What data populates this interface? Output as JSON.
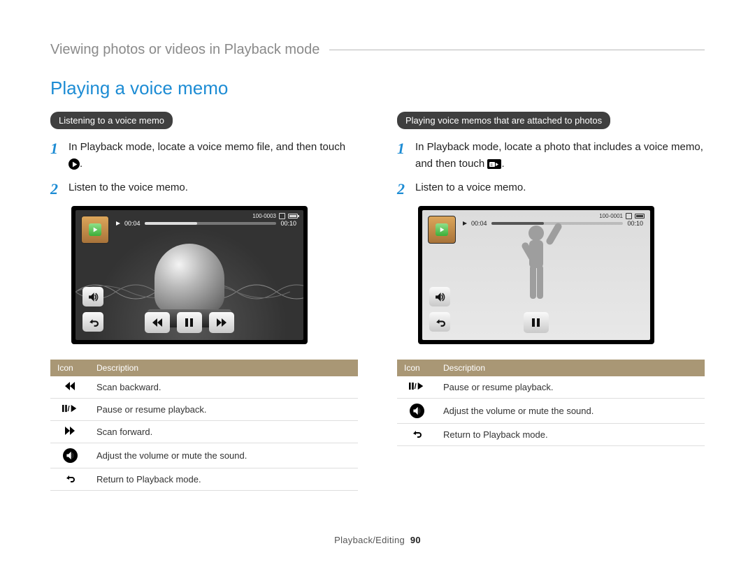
{
  "breadcrumb": "Viewing photos or videos in Playback mode",
  "section_title": "Playing a voice memo",
  "left": {
    "subtitle": "Listening to a voice memo",
    "step1": "In Playback mode, locate a voice memo file, and then touch",
    "step1_tail": ".",
    "step2": "Listen to the voice memo.",
    "screen": {
      "elapsed": "00:04",
      "total": "00:10",
      "file_no": "100-0003",
      "progress_pct": 40
    },
    "table_header_icon": "Icon",
    "table_header_desc": "Description",
    "rows": [
      {
        "icon": "rew",
        "text": "Scan backward."
      },
      {
        "icon": "pauseplay",
        "text": "Pause or resume playback."
      },
      {
        "icon": "ffwd",
        "text": "Scan forward."
      },
      {
        "icon": "volume",
        "text": "Adjust the volume or mute the sound."
      },
      {
        "icon": "return",
        "text": "Return to Playback mode."
      }
    ]
  },
  "right": {
    "subtitle": "Playing voice memos that are attached to photos",
    "step1": "In Playback mode, locate a photo that includes a voice memo, and then touch",
    "step1_tail": ".",
    "step2": "Listen to a voice memo.",
    "screen": {
      "elapsed": "00:04",
      "total": "00:10",
      "file_no": "100-0001",
      "progress_pct": 40
    },
    "table_header_icon": "Icon",
    "table_header_desc": "Description",
    "rows": [
      {
        "icon": "pauseplay",
        "text": "Pause or resume playback."
      },
      {
        "icon": "volume",
        "text": "Adjust the volume or mute the sound."
      },
      {
        "icon": "return",
        "text": "Return to Playback mode."
      }
    ]
  },
  "footer_section": "Playback/Editing",
  "footer_page": "90"
}
